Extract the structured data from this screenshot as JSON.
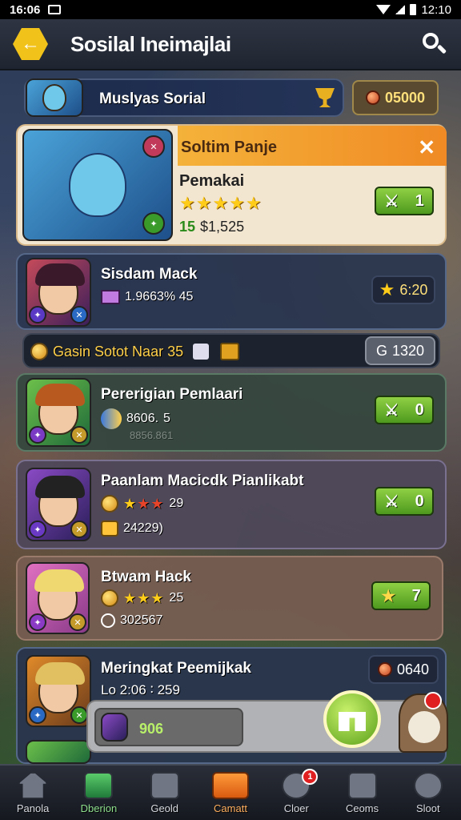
{
  "status": {
    "time": "16:06",
    "clock_right": "12:10"
  },
  "header": {
    "title": "Sosilal Ineimajlai"
  },
  "profile": {
    "name": "Muslyas Sorial",
    "currency": "05000"
  },
  "featured": {
    "banner_title": "Soltim Panje",
    "name": "Pemakai",
    "stars": "★★★★★",
    "price_prefix": "15",
    "price": "$1,525",
    "button_value": "1"
  },
  "players": [
    {
      "name": "Sisdam Mack",
      "stat": "1.9663% 45",
      "badge": "6:20"
    },
    {
      "name": "Pererigian Pemlaari",
      "stat": "8606.",
      "stat_suffix": "5",
      "faded": "8856.861",
      "button_value": "0"
    },
    {
      "name": "Paanlam Macicdk Pianlikabt",
      "stars_gold": "★",
      "stars_red": "★★",
      "level": "29",
      "stat": "24229)",
      "button_value": "0"
    },
    {
      "name": "Btwam Hack",
      "stars": "★★★",
      "level": "25",
      "stat": "302567",
      "button_value": "7"
    },
    {
      "name": "Meringkat Peemijkak",
      "stat": "Lo 2:06 ∶ 259",
      "badge": "0640"
    }
  ],
  "gold_bar": {
    "label": "Gasin Sotot Naar 35",
    "value": "1320",
    "value_prefix": "G"
  },
  "chat_overlay": {
    "value": "906"
  },
  "nav": [
    {
      "label": "Panola"
    },
    {
      "label": "Dberion"
    },
    {
      "label": "Geold"
    },
    {
      "label": "Camatt"
    },
    {
      "label": "Cloer",
      "badge": "1"
    },
    {
      "label": "Ceoms"
    },
    {
      "label": "Sloot"
    }
  ],
  "colors": {
    "accent_green": "#6cb830",
    "accent_orange": "#f08a24",
    "gold": "#f0c21a"
  }
}
